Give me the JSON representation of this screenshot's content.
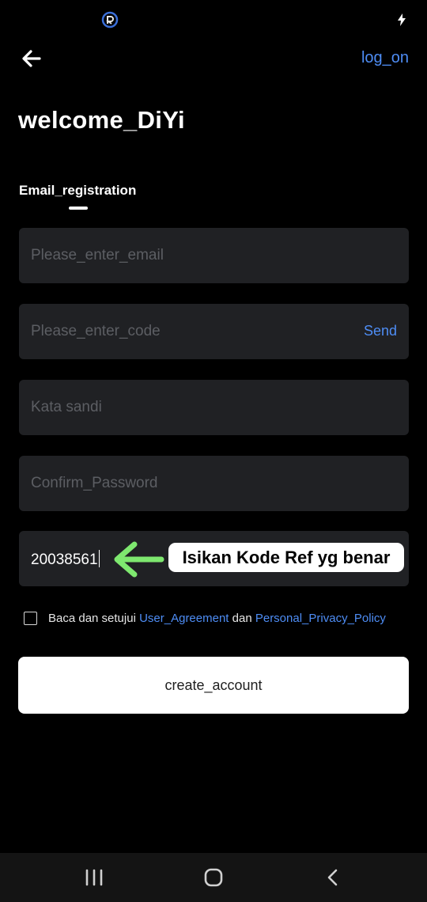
{
  "status_bar": {
    "app_icon": "app-logo-icon",
    "flash_icon": "flash-icon"
  },
  "header": {
    "back_icon": "arrow-left-icon",
    "login_label": "log_on"
  },
  "title": "welcome_DiYi",
  "tabs": [
    {
      "label": "Email_registration",
      "active": true
    }
  ],
  "form": {
    "email_placeholder": "Please_enter_email",
    "code_placeholder": "Please_enter_code",
    "send_label": "Send",
    "password_placeholder": "Kata sandi",
    "confirm_placeholder": "Confirm_Password",
    "referral_value": "20038561"
  },
  "annotation": {
    "arrow_icon": "green-arrow-left-icon",
    "text": "Isikan Kode Ref yg benar"
  },
  "agreement": {
    "prefix": "Baca dan setujui ",
    "user_agreement": "User_Agreement",
    "conjunction": " dan ",
    "privacy_policy": "Personal_Privacy_Policy",
    "checked": false
  },
  "create_button_label": "create_account",
  "nav_bar": {
    "recent_icon": "recent-apps-icon",
    "home_icon": "home-icon",
    "back_icon": "back-icon"
  },
  "colors": {
    "background": "#000000",
    "field": "#202124",
    "accent": "#4e8df5",
    "annotation_arrow": "#7ee86f"
  }
}
